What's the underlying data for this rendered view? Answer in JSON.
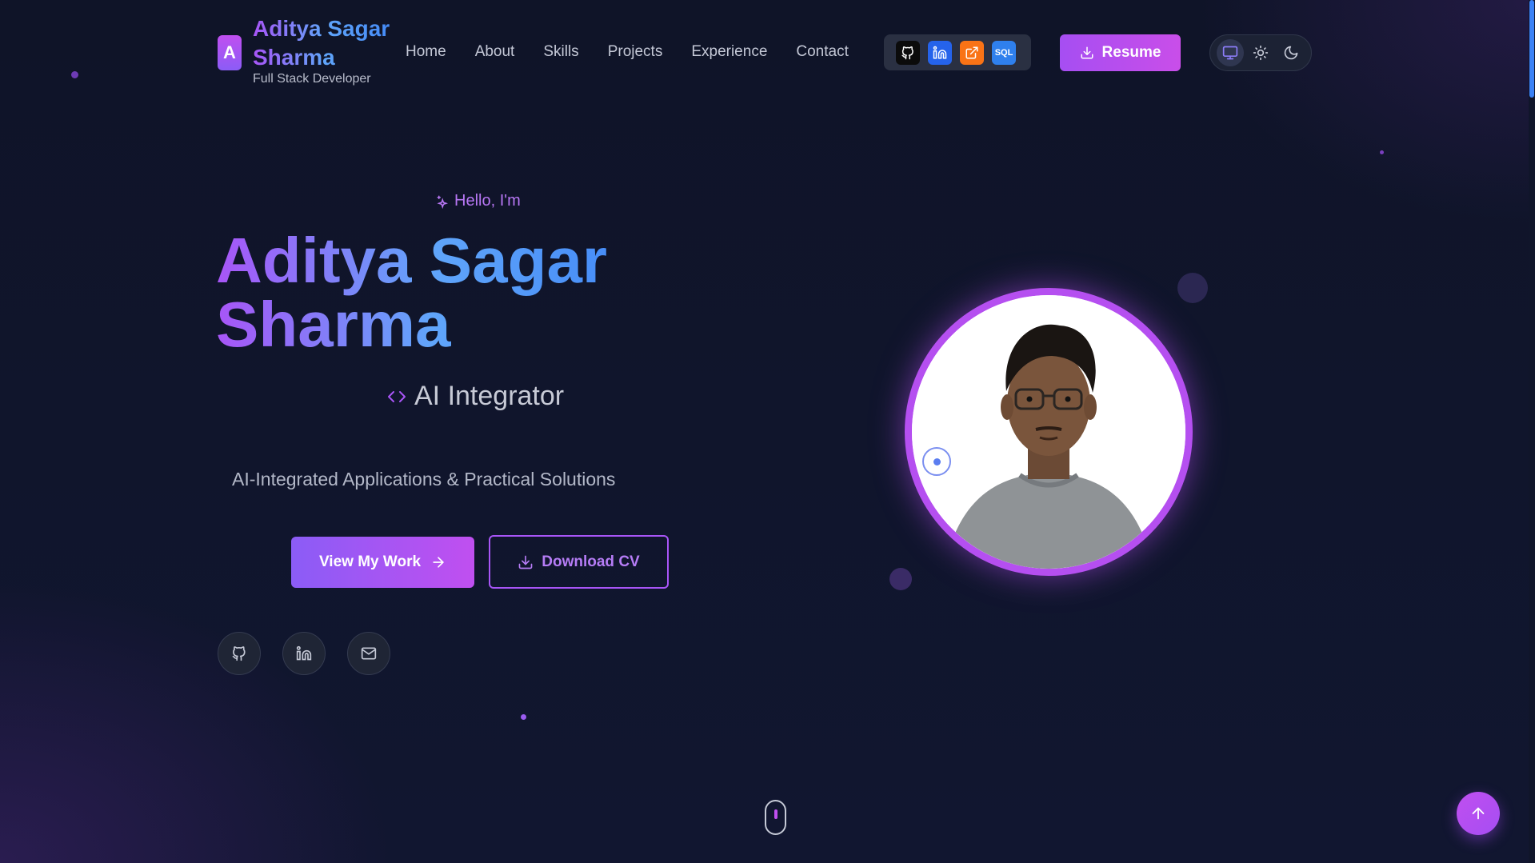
{
  "brand": {
    "logo_letter": "A",
    "name": "Aditya Sagar Sharma",
    "subtitle": "Full Stack Developer"
  },
  "nav": {
    "items": [
      {
        "label": "Home"
      },
      {
        "label": "About"
      },
      {
        "label": "Skills"
      },
      {
        "label": "Projects"
      },
      {
        "label": "Experience"
      },
      {
        "label": "Contact"
      }
    ]
  },
  "external_links": [
    {
      "icon": "github-icon",
      "color": "#0b0b0b"
    },
    {
      "icon": "linkedin-icon",
      "color": "#2563eb"
    },
    {
      "icon": "external-link-icon",
      "color": "#f97316"
    },
    {
      "icon": "sql-icon",
      "label": "SQL",
      "color": "#2f80ed"
    }
  ],
  "resume_button": {
    "label": "Resume"
  },
  "theme_toggle": {
    "options": [
      "monitor-icon",
      "sun-icon",
      "moon-icon"
    ],
    "active": "monitor-icon"
  },
  "hero": {
    "greeting": "Hello, I'm",
    "name": "Aditya Sagar Sharma",
    "role": "AI Integrator",
    "tagline": "AI-Integrated Applications & Practical Solutions",
    "primary_button": "View My Work",
    "secondary_button": "Download CV",
    "socials": [
      "github-icon",
      "linkedin-icon",
      "mail-icon"
    ]
  },
  "colors": {
    "accent": "#a855f7",
    "accent_pink": "#c04ff0",
    "accent_blue": "#3b82f6",
    "background": "#0f1428"
  }
}
